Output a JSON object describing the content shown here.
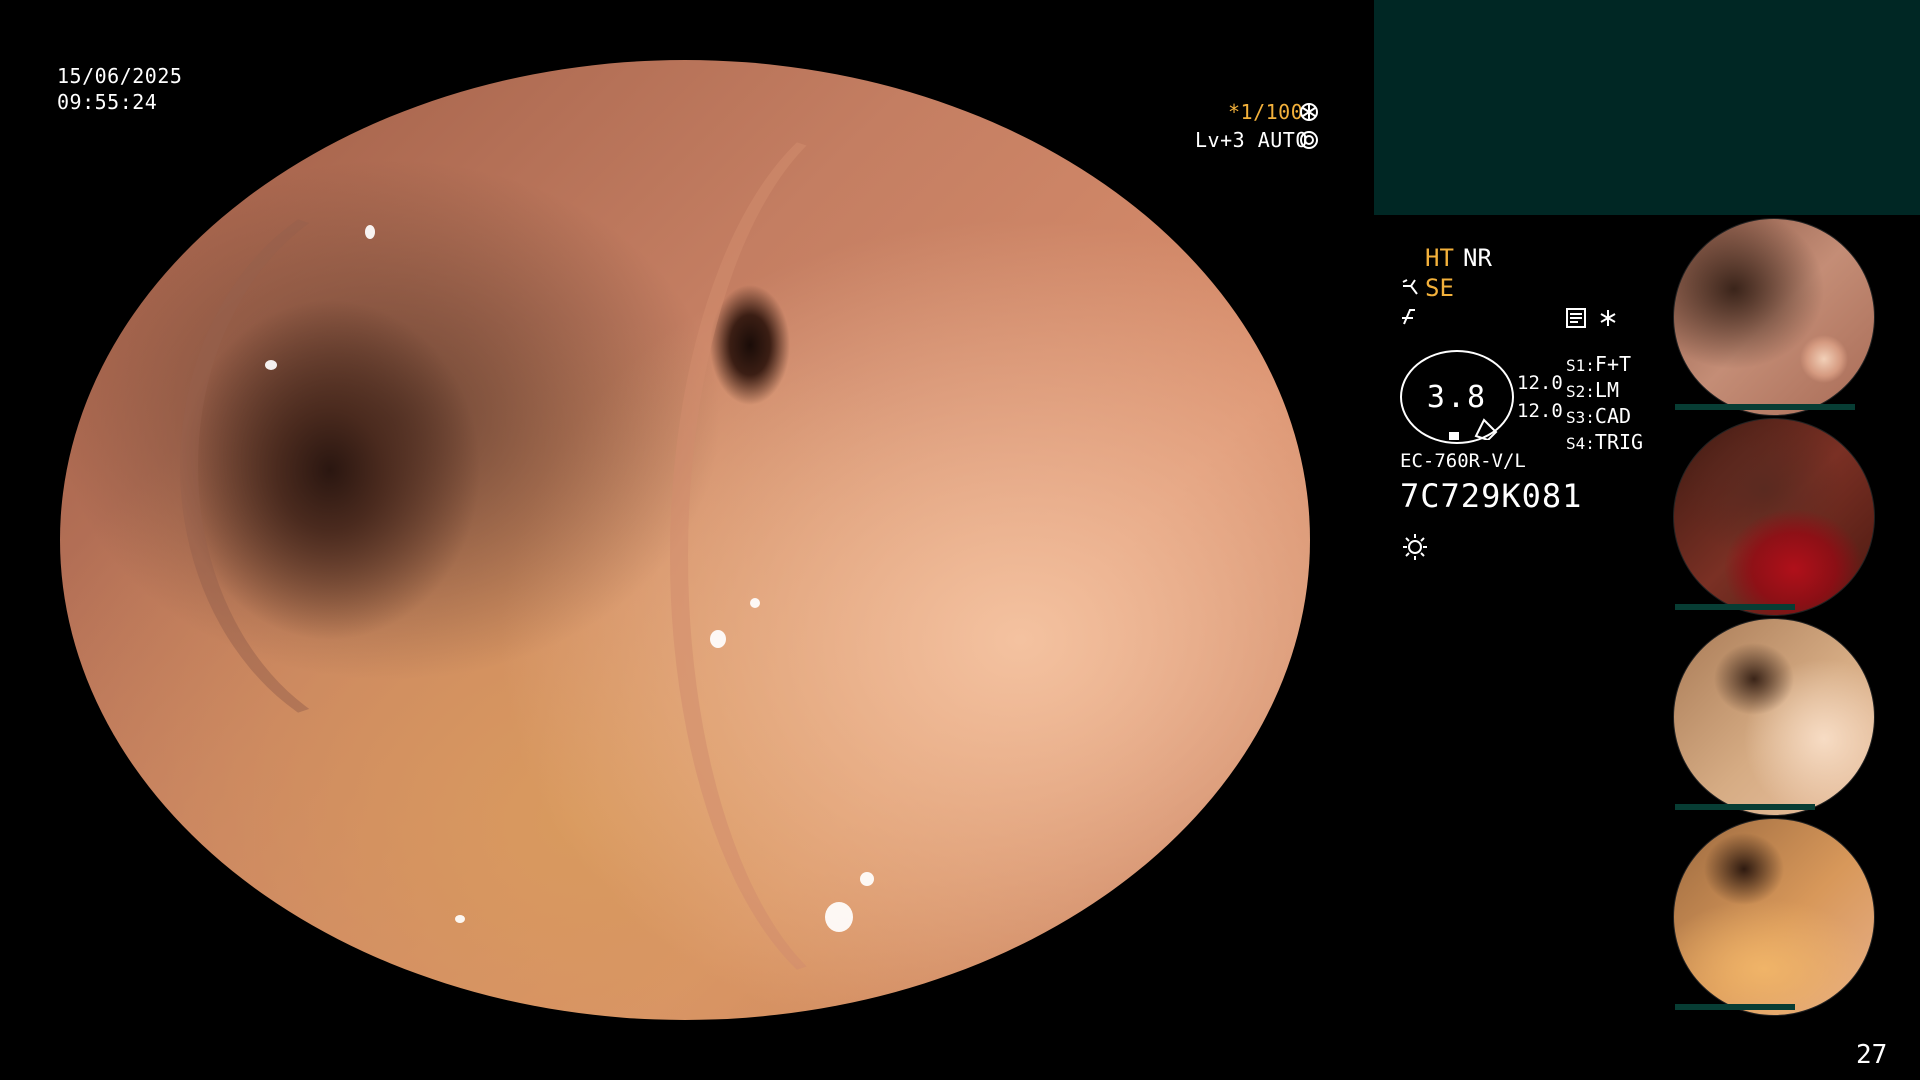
{
  "header": {
    "date": "15/06/2025",
    "time": "09:55:24",
    "shutter": "*1/100",
    "level": "Lv+3 AUTO"
  },
  "modes": {
    "ht": "HT",
    "nr": "NR",
    "se": "SE"
  },
  "settings": {
    "gauge_value": "3.8",
    "value_top": "12.0",
    "value_bottom": "12.0",
    "s1_label": "S1:",
    "s1_value": "F+T",
    "s2_label": "S2:",
    "s2_value": "LM",
    "s3_label": "S3:",
    "s3_value": "CAD",
    "s4_label": "S4:",
    "s4_value": "TRIG"
  },
  "device": {
    "model": "EC-760R-V/L",
    "serial": "7C729K081"
  },
  "footer": {
    "frame_count": "27"
  },
  "thumbnails": [
    {
      "id": "thumb-1",
      "label": "captured frame 1"
    },
    {
      "id": "thumb-2",
      "label": "captured frame 2"
    },
    {
      "id": "thumb-3",
      "label": "captured frame 3"
    },
    {
      "id": "thumb-4",
      "label": "captured frame 4"
    }
  ],
  "colors": {
    "accent_amber": "#f3b13b",
    "panel_teal": "#002724",
    "background": "#000000"
  },
  "icons": [
    "shutter-icon",
    "auto-iris-icon",
    "scope-mode-icon",
    "enhance-icon",
    "record-icon",
    "asterisk-icon",
    "light-icon"
  ]
}
